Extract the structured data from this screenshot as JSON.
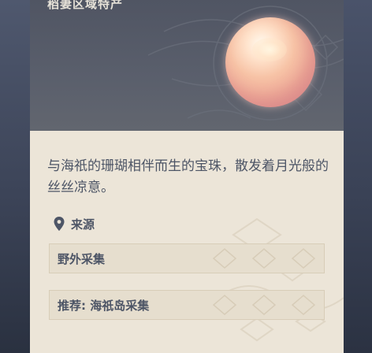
{
  "header": {
    "region_label": "稻妻区域特产"
  },
  "item": {
    "image": "pearl-icon",
    "description": "与海祇的珊瑚相伴而生的宝珠，散发着月光般的丝丝凉意。"
  },
  "source": {
    "icon": "location-pin-icon",
    "title": "来源",
    "entries": [
      {
        "label": "野外采集"
      },
      {
        "label": "推荐: 海祇岛采集"
      }
    ]
  },
  "colors": {
    "header_bg": "#555a67",
    "body_bg": "#ece5d8",
    "text": "#4d5566",
    "pearl": "#f3bfa6"
  }
}
